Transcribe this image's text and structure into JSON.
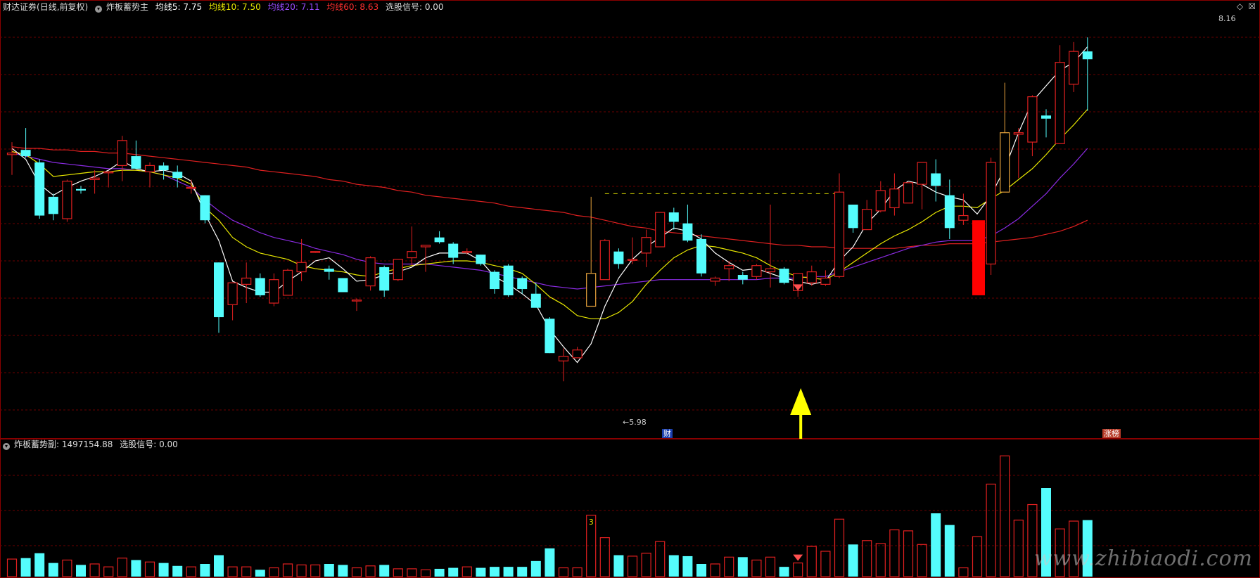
{
  "main": {
    "broker": "财达证券",
    "mode": "(日线,前复权)",
    "indicator_name": "炸板蓄势主",
    "ma5": {
      "label": "均线5: 7.75",
      "color": "#ffffff"
    },
    "ma10": {
      "label": "均线10: 7.50",
      "color": "#e8e800"
    },
    "ma20": {
      "label": "均线20: 7.11",
      "color": "#8a2be2"
    },
    "ma60": {
      "label": "均线60: 8.63",
      "color": "#e02020"
    },
    "signal": "选股信号: 0.00",
    "high_label": "8.16",
    "low_label": "5.98",
    "marker_cai": "财",
    "marker_zhangting": "涨榜",
    "corner_icons": [
      "diamond-icon",
      "close-icon"
    ]
  },
  "sub": {
    "indicator_name": "炸板蓄势副",
    "value": ": 1497154.88",
    "signal": "选股信号: 0.00",
    "volume_flag": "3"
  },
  "watermark": "www.zhibiaodi.com",
  "colors": {
    "up": "#e02020",
    "down": "#54fcfc",
    "zt": "#ff0000",
    "grid": "#6a0000",
    "arrow": "#ffff00"
  },
  "chart_data": {
    "type": "candlestick",
    "bars": 79,
    "price_range": [
      5.7,
      8.3
    ],
    "candles": [
      [
        7.41,
        7.49,
        7.28,
        7.42
      ],
      [
        7.44,
        7.58,
        7.39,
        7.4
      ],
      [
        7.36,
        7.38,
        7.0,
        7.02
      ],
      [
        7.14,
        7.16,
        6.99,
        7.03
      ],
      [
        7.0,
        7.25,
        6.98,
        7.24
      ],
      [
        7.19,
        7.21,
        7.16,
        7.18
      ],
      [
        7.25,
        7.31,
        7.16,
        7.26
      ],
      [
        7.3,
        7.3,
        7.2,
        7.3
      ],
      [
        7.34,
        7.53,
        7.24,
        7.5
      ],
      [
        7.4,
        7.5,
        7.32,
        7.32
      ],
      [
        7.3,
        7.36,
        7.2,
        7.34
      ],
      [
        7.34,
        7.36,
        7.25,
        7.31
      ],
      [
        7.3,
        7.34,
        7.2,
        7.26
      ],
      [
        7.2,
        7.25,
        7.16,
        7.2
      ],
      [
        7.15,
        7.15,
        6.97,
        6.99
      ],
      [
        6.72,
        6.72,
        6.27,
        6.37
      ],
      [
        6.45,
        6.58,
        6.35,
        6.59
      ],
      [
        6.58,
        6.72,
        6.46,
        6.62
      ],
      [
        6.62,
        6.65,
        6.5,
        6.51
      ],
      [
        6.46,
        6.65,
        6.44,
        6.61
      ],
      [
        6.51,
        6.68,
        6.51,
        6.67
      ],
      [
        6.66,
        6.87,
        6.6,
        6.72
      ],
      [
        6.79,
        6.79,
        6.78,
        6.79
      ],
      [
        6.68,
        6.7,
        6.61,
        6.66
      ],
      [
        6.62,
        6.62,
        6.53,
        6.53
      ],
      [
        6.48,
        6.49,
        6.41,
        6.48
      ],
      [
        6.57,
        6.76,
        6.54,
        6.75
      ],
      [
        6.69,
        6.7,
        6.5,
        6.54
      ],
      [
        6.61,
        6.74,
        6.6,
        6.74
      ],
      [
        6.75,
        6.95,
        6.7,
        6.79
      ],
      [
        6.82,
        6.83,
        6.66,
        6.83
      ],
      [
        6.88,
        6.92,
        6.84,
        6.85
      ],
      [
        6.84,
        6.85,
        6.71,
        6.75
      ],
      [
        6.79,
        6.81,
        6.77,
        6.79
      ],
      [
        6.77,
        6.77,
        6.7,
        6.71
      ],
      [
        6.66,
        6.67,
        6.52,
        6.55
      ],
      [
        6.7,
        6.71,
        6.5,
        6.51
      ],
      [
        6.62,
        6.63,
        6.52,
        6.55
      ],
      [
        6.52,
        6.59,
        6.44,
        6.43
      ],
      [
        6.36,
        6.37,
        6.14,
        6.14
      ],
      [
        6.09,
        6.17,
        5.96,
        6.12
      ],
      [
        6.11,
        6.18,
        6.11,
        6.16
      ],
      [
        6.44,
        7.14,
        6.47,
        6.65
      ],
      [
        6.61,
        6.87,
        6.61,
        6.86
      ],
      [
        6.79,
        6.81,
        6.68,
        6.71
      ],
      [
        6.74,
        6.88,
        6.71,
        6.74
      ],
      [
        6.78,
        6.93,
        6.69,
        6.88
      ],
      [
        6.82,
        7.04,
        6.84,
        7.04
      ],
      [
        7.04,
        7.07,
        6.93,
        6.98
      ],
      [
        6.97,
        7.09,
        6.85,
        6.86
      ],
      [
        6.87,
        6.9,
        6.63,
        6.65
      ],
      [
        6.6,
        6.63,
        6.57,
        6.62
      ],
      [
        6.68,
        6.73,
        6.6,
        6.7
      ],
      [
        6.64,
        6.66,
        6.58,
        6.61
      ],
      [
        6.63,
        6.71,
        6.61,
        6.7
      ],
      [
        6.66,
        7.09,
        6.56,
        6.68
      ],
      [
        6.68,
        6.69,
        6.58,
        6.59
      ],
      [
        6.54,
        6.65,
        6.5,
        6.65
      ],
      [
        6.59,
        6.7,
        6.57,
        6.66
      ],
      [
        6.58,
        6.67,
        6.57,
        6.62
      ],
      [
        6.63,
        7.29,
        6.62,
        7.17
      ],
      [
        7.09,
        7.09,
        6.91,
        6.94
      ],
      [
        6.93,
        7.12,
        6.95,
        7.06
      ],
      [
        7.05,
        7.24,
        7.04,
        7.18
      ],
      [
        7.07,
        7.29,
        7.02,
        7.19
      ],
      [
        7.1,
        7.23,
        7.11,
        7.23
      ],
      [
        7.22,
        7.35,
        7.06,
        7.36
      ],
      [
        7.29,
        7.38,
        7.11,
        7.21
      ],
      [
        7.15,
        7.25,
        6.87,
        6.94
      ],
      [
        6.99,
        7.16,
        6.96,
        7.02
      ],
      [
        6.88,
        6.99,
        6.51,
        6.55
      ],
      [
        6.71,
        7.39,
        6.64,
        7.36
      ],
      [
        7.17,
        7.87,
        7.26,
        7.55
      ],
      [
        7.54,
        7.58,
        7.26,
        7.55
      ],
      [
        7.49,
        7.79,
        7.4,
        7.78
      ],
      [
        7.66,
        7.7,
        7.52,
        7.64
      ],
      [
        7.48,
        8.11,
        7.56,
        8.0
      ],
      [
        7.86,
        8.13,
        7.81,
        8.07
      ],
      [
        8.07,
        8.16,
        7.69,
        8.02
      ]
    ],
    "ma": {
      "ma5": [
        7.45,
        7.38,
        7.22,
        7.15,
        7.2,
        7.24,
        7.27,
        7.31,
        7.37,
        7.32,
        7.3,
        7.31,
        7.29,
        7.24,
        7.03,
        6.86,
        6.6,
        6.56,
        6.53,
        6.53,
        6.6,
        6.66,
        6.73,
        6.75,
        6.68,
        6.6,
        6.61,
        6.64,
        6.66,
        6.69,
        6.75,
        6.78,
        6.78,
        6.78,
        6.73,
        6.63,
        6.58,
        6.52,
        6.45,
        6.29,
        6.18,
        6.08,
        6.2,
        6.44,
        6.62,
        6.74,
        6.82,
        6.88,
        6.94,
        6.92,
        6.87,
        6.78,
        6.72,
        6.67,
        6.68,
        6.65,
        6.62,
        6.6,
        6.58,
        6.6,
        6.73,
        6.82,
        6.97,
        7.06,
        7.18,
        7.24,
        7.22,
        7.17,
        7.14,
        7.12,
        7.03,
        7.15,
        7.32,
        7.55,
        7.75,
        7.85,
        7.95,
        8.0,
        8.1
      ],
      "ma10": [
        7.43,
        7.41,
        7.35,
        7.27,
        7.28,
        7.29,
        7.3,
        7.3,
        7.31,
        7.31,
        7.3,
        7.28,
        7.26,
        7.22,
        7.07,
        6.99,
        6.88,
        6.82,
        6.78,
        6.76,
        6.74,
        6.7,
        6.68,
        6.67,
        6.66,
        6.64,
        6.63,
        6.66,
        6.68,
        6.7,
        6.71,
        6.72,
        6.73,
        6.73,
        6.72,
        6.7,
        6.68,
        6.65,
        6.58,
        6.5,
        6.45,
        6.38,
        6.36,
        6.36,
        6.4,
        6.47,
        6.58,
        6.67,
        6.75,
        6.8,
        6.83,
        6.82,
        6.8,
        6.78,
        6.75,
        6.7,
        6.66,
        6.63,
        6.62,
        6.61,
        6.66,
        6.72,
        6.78,
        6.84,
        6.89,
        6.93,
        6.98,
        7.04,
        7.08,
        7.08,
        7.07,
        7.13,
        7.18,
        7.25,
        7.32,
        7.41,
        7.51,
        7.6,
        7.7
      ],
      "ma20": [
        7.42,
        7.4,
        7.38,
        7.36,
        7.35,
        7.34,
        7.33,
        7.32,
        7.32,
        7.31,
        7.3,
        7.28,
        7.24,
        7.2,
        7.12,
        7.05,
        6.99,
        6.95,
        6.91,
        6.88,
        6.86,
        6.84,
        6.81,
        6.79,
        6.77,
        6.74,
        6.72,
        6.71,
        6.71,
        6.71,
        6.71,
        6.7,
        6.69,
        6.68,
        6.67,
        6.65,
        6.63,
        6.61,
        6.59,
        6.57,
        6.56,
        6.55,
        6.56,
        6.57,
        6.58,
        6.59,
        6.6,
        6.61,
        6.61,
        6.61,
        6.61,
        6.61,
        6.61,
        6.61,
        6.61,
        6.62,
        6.62,
        6.62,
        6.63,
        6.63,
        6.66,
        6.69,
        6.72,
        6.75,
        6.78,
        6.81,
        6.83,
        6.85,
        6.86,
        6.86,
        6.86,
        6.89,
        6.94,
        7.0,
        7.08,
        7.16,
        7.26,
        7.35,
        7.45
      ],
      "ma60": [
        7.46,
        7.45,
        7.45,
        7.44,
        7.44,
        7.43,
        7.43,
        7.42,
        7.42,
        7.41,
        7.4,
        7.39,
        7.38,
        7.37,
        7.36,
        7.35,
        7.34,
        7.33,
        7.31,
        7.3,
        7.29,
        7.28,
        7.27,
        7.25,
        7.24,
        7.22,
        7.21,
        7.2,
        7.18,
        7.17,
        7.15,
        7.14,
        7.13,
        7.12,
        7.11,
        7.1,
        7.08,
        7.07,
        7.06,
        7.05,
        7.04,
        7.02,
        7.01,
        6.99,
        6.97,
        6.95,
        6.94,
        6.92,
        6.91,
        6.9,
        6.89,
        6.88,
        6.87,
        6.86,
        6.85,
        6.84,
        6.83,
        6.83,
        6.82,
        6.82,
        6.81,
        6.81,
        6.81,
        6.81,
        6.81,
        6.82,
        6.83,
        6.83,
        6.84,
        6.84,
        6.84,
        6.85,
        6.86,
        6.87,
        6.88,
        6.9,
        6.92,
        6.95,
        6.99
      ]
    },
    "volume": [
      18,
      19,
      24,
      14,
      17,
      12,
      13,
      10,
      19,
      17,
      15,
      14,
      11,
      10,
      13,
      22,
      10,
      10,
      7,
      9,
      13,
      12,
      12,
      13,
      12,
      9,
      11,
      12,
      8,
      8,
      7,
      8,
      9,
      10,
      9,
      10,
      10,
      10,
      16,
      29,
      9,
      9,
      63,
      40,
      22,
      21,
      24,
      36,
      22,
      21,
      13,
      13,
      20,
      20,
      17,
      20,
      10,
      14,
      31,
      26,
      59,
      33,
      37,
      34,
      48,
      47,
      33,
      65,
      53,
      9,
      41,
      95,
      124,
      58,
      74,
      91,
      49,
      57,
      58
    ],
    "zhangting_bar": 70,
    "signal_bar": 57,
    "flag_bar": 42,
    "volume_range": [
      0,
      130
    ]
  }
}
